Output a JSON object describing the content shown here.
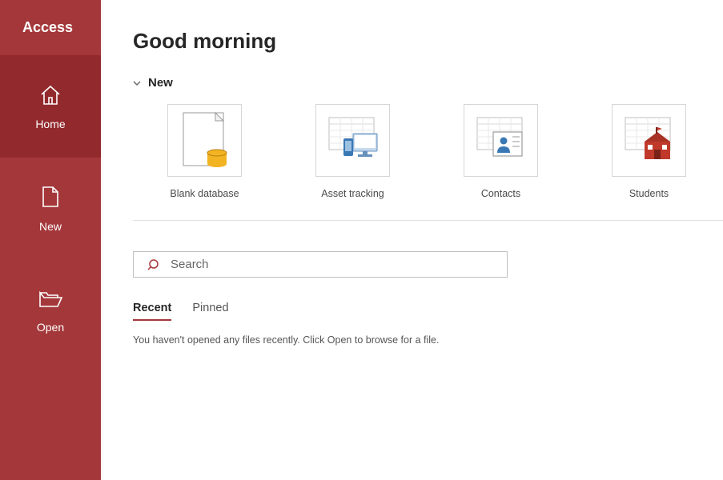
{
  "app": {
    "name": "Access"
  },
  "sidebar": {
    "items": [
      {
        "label": "Home"
      },
      {
        "label": "New"
      },
      {
        "label": "Open"
      }
    ]
  },
  "page": {
    "title": "Good morning"
  },
  "new_section": {
    "heading": "New",
    "templates": [
      {
        "label": "Blank database"
      },
      {
        "label": "Asset tracking"
      },
      {
        "label": "Contacts"
      },
      {
        "label": "Students"
      }
    ]
  },
  "search": {
    "placeholder": "Search"
  },
  "tabs": [
    {
      "label": "Recent"
    },
    {
      "label": "Pinned"
    }
  ],
  "empty_message": "You haven't opened any files recently. Click Open to browse for a file."
}
